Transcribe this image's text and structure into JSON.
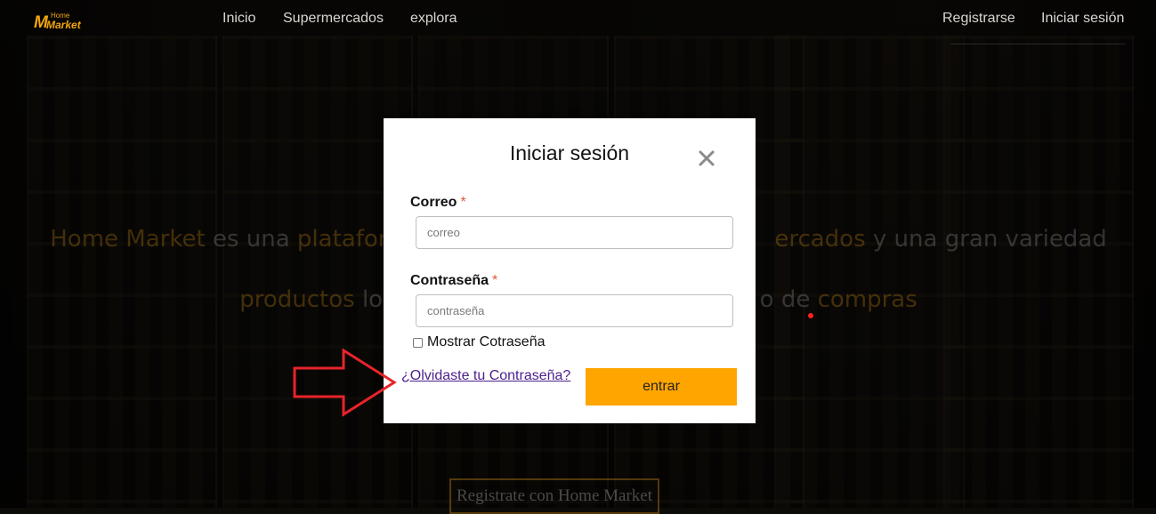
{
  "navbar": {
    "logo_home": "Home",
    "logo_market": "Market",
    "links": [
      "Inicio",
      "Supermercados",
      "explora"
    ],
    "right_links": [
      "Registrarse",
      "Iniciar sesión"
    ]
  },
  "hero": {
    "line1_part1": "Home Market",
    "line1_part2": " es una ",
    "line1_part3": "plataform",
    "line1_part4": "ercados",
    "line1_part5": " y una gran variedad de",
    "line2_part1": "productos",
    "line2_part2": " los",
    "line2_part3": "o de ",
    "line2_part4": "compras",
    "cta_label": "Registrate con Home Market"
  },
  "modal": {
    "title": "Iniciar sesión",
    "email_label": "Correo",
    "email_placeholder": "correo",
    "password_label": "Contraseña",
    "password_placeholder": "contraseña",
    "required_mark": "*",
    "show_password_label": "Mostrar Cotraseña",
    "forgot_link": "¿Olvidaste tu Contraseña?",
    "submit_label": "entrar"
  },
  "colors": {
    "accent": "#ffa500",
    "link": "#4b1e8c",
    "annotation": "#e8232a",
    "required": "#e0573a"
  },
  "icons": {
    "close": "close-icon",
    "annotation": "arrow-right-icon"
  }
}
